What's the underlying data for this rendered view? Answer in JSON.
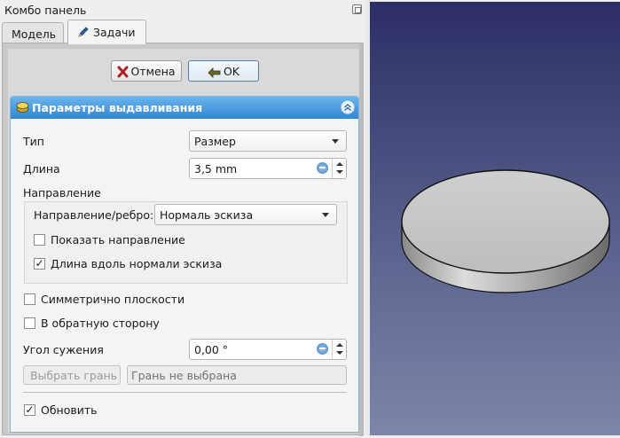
{
  "combo_panel": {
    "title": "Комбо панель"
  },
  "tabs": [
    {
      "label": "Модель"
    },
    {
      "label": "Задачи"
    }
  ],
  "buttons": {
    "cancel": "Отмена",
    "ok": "OK"
  },
  "pad_params": {
    "header": "Параметры выдавливания",
    "type_label": "Тип",
    "type_value": "Размер",
    "length_label": "Длина",
    "length_value": "3,5 mm",
    "direction_section": "Направление",
    "direction_edge_label": "Направление/ребро:",
    "direction_edge_value": "Нормаль эскиза",
    "show_direction": {
      "label": "Показать направление",
      "checked": false
    },
    "along_normal": {
      "label": "Длина вдоль нормали эскиза",
      "checked": true
    },
    "symmetric": {
      "label": "Симметрично плоскости",
      "checked": false
    },
    "reversed": {
      "label": "В обратную сторону",
      "checked": false
    },
    "taper_label": "Угол сужения",
    "taper_value": "0,00 °",
    "select_face_button": "Выбрать грань",
    "face_field_value": "Грань не выбрана",
    "update": {
      "label": "Обновить",
      "checked": true
    }
  },
  "colors": {
    "header_blue": "#2f86d2",
    "viewport_top": "#2c2e66",
    "viewport_bottom": "#7d86a8",
    "solid_gray": "#c8c8c8"
  }
}
